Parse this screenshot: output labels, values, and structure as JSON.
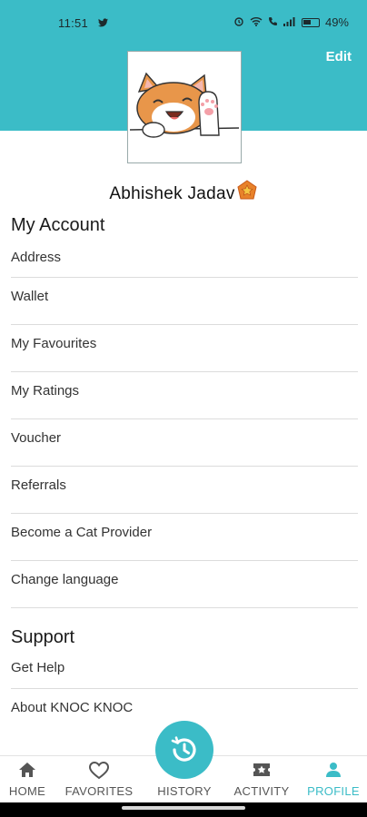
{
  "status": {
    "time": "11:51",
    "battery": "49%"
  },
  "header": {
    "edit_label": "Edit"
  },
  "profile": {
    "name": "Abhishek Jadav"
  },
  "account": {
    "title": "My Account",
    "items": [
      "Address",
      "Wallet",
      "My Favourites",
      "My Ratings",
      "Voucher",
      "Referrals",
      "Become a Cat Provider",
      "Change language"
    ]
  },
  "support": {
    "title": "Support",
    "items": [
      "Get Help",
      "About KNOC KNOC"
    ]
  },
  "nav": {
    "home": "HOME",
    "favorites": "FAVORITES",
    "history": "HISTORY",
    "activity": "ACTIVITY",
    "profile": "PROFILE"
  },
  "colors": {
    "accent": "#3bbcc7"
  }
}
